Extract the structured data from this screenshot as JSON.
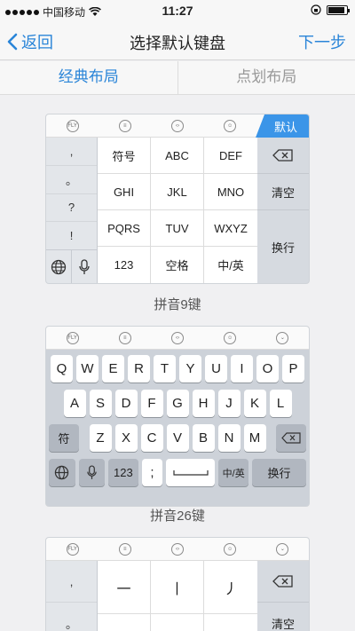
{
  "status": {
    "carrier": "中国移动",
    "time": "11:27"
  },
  "nav": {
    "back_label": "返回",
    "title": "选择默认键盘",
    "next_label": "下一步"
  },
  "tabs": [
    {
      "label": "经典布局"
    },
    {
      "label": "点划布局"
    }
  ],
  "default_badge": "默认",
  "nine_key": {
    "punct": [
      ",",
      "。",
      "?",
      "!"
    ],
    "grid": [
      "符号",
      "ABC",
      "DEF",
      "GHI",
      "JKL",
      "MNO",
      "PQRS",
      "TUV",
      "WXYZ",
      "123",
      "空格",
      "中/英"
    ],
    "right": [
      "清空",
      "换行"
    ],
    "caption": "拼音9键"
  },
  "qwerty": {
    "row1": [
      "Q",
      "W",
      "E",
      "R",
      "T",
      "Y",
      "U",
      "I",
      "O",
      "P"
    ],
    "row2": [
      "A",
      "S",
      "D",
      "F",
      "G",
      "H",
      "J",
      "K",
      "L"
    ],
    "row3_left": "符",
    "row3": [
      "Z",
      "X",
      "C",
      "V",
      "B",
      "N",
      "M"
    ],
    "row4": {
      "num": "123",
      "punct": ";",
      "lang": "中/英",
      "enter": "换行"
    },
    "caption": "拼音26键"
  },
  "stroke_key": {
    "punct": [
      ",",
      "。"
    ],
    "strokes": [
      "一",
      "丨",
      "丿"
    ],
    "right": "清空"
  }
}
